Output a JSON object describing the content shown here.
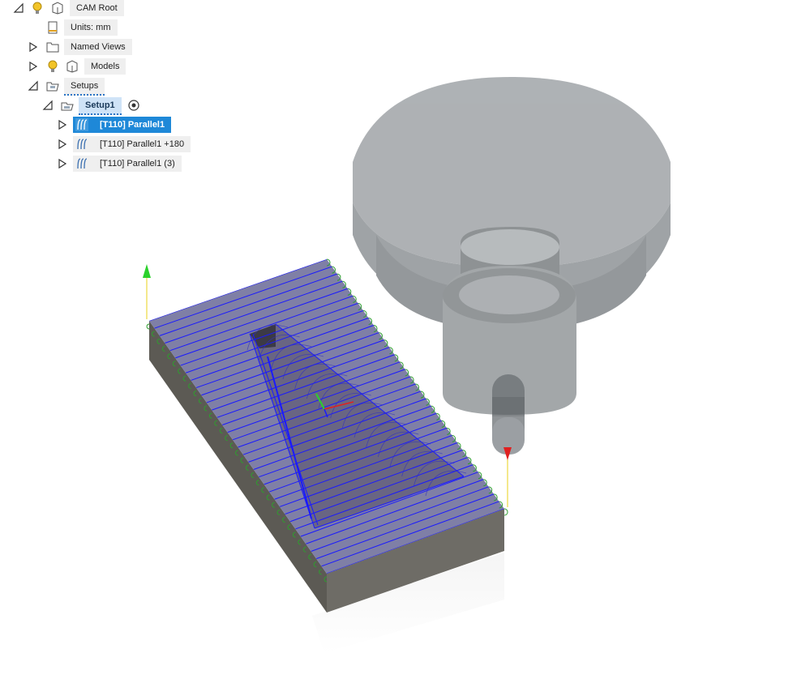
{
  "browser": {
    "root": {
      "label": "CAM Root"
    },
    "units": {
      "label": "Units: mm"
    },
    "named_views": {
      "label": "Named Views"
    },
    "models": {
      "label": "Models"
    },
    "setups": {
      "label": "Setups"
    },
    "setup1": {
      "label": "Setup1"
    },
    "operations": [
      {
        "label": "[T110] Parallel1",
        "selected": true
      },
      {
        "label": "[T110] Parallel1 +180",
        "selected": false
      },
      {
        "label": "[T110] Parallel1 (3)",
        "selected": false
      }
    ]
  },
  "colors": {
    "toolpath": "#1a1aff",
    "lead": "#2e9e2e",
    "stock_side": "#5b5953",
    "stock_top": "#8a8ab0",
    "tool": "#6e7478",
    "axis_z": "#2bd12b",
    "axis_x": "#e02020",
    "selection": "#1e88d8"
  }
}
